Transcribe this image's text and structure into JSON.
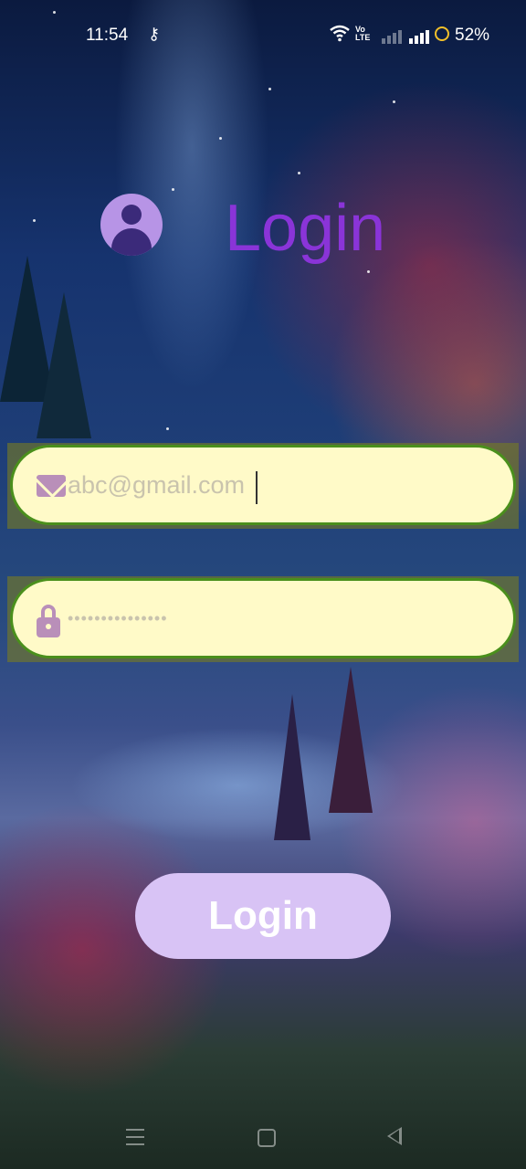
{
  "status_bar": {
    "time": "11:54",
    "network_label": "Vo\nLTE",
    "battery_text": "52%",
    "icons": [
      "key-icon",
      "wifi-icon",
      "signal-icon",
      "battery-icon"
    ]
  },
  "header": {
    "title": "Login",
    "avatar_icon": "account-circle-icon",
    "title_color": "#8a34d8"
  },
  "form": {
    "email_placeholder": "abc@gmail.com",
    "email_value": "",
    "password_mask": "•••••••••••••••",
    "field_background": "#fffac8",
    "field_border": "#4a8f1c"
  },
  "login_button": {
    "label": "Login",
    "color": "#d8c3f5"
  },
  "nav_bar": {
    "icons": [
      "menu-icon",
      "home-icon",
      "back-icon"
    ]
  }
}
